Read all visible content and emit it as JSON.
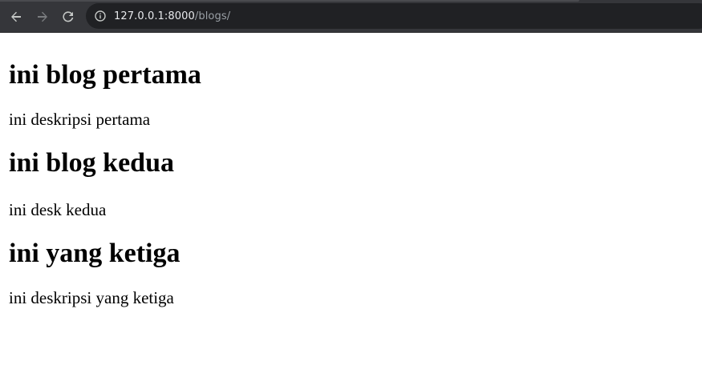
{
  "browser": {
    "url_host": "127.0.0.1:8000",
    "url_path": "/blogs/",
    "back_icon": "arrow-left-icon",
    "forward_icon": "arrow-right-icon",
    "reload_icon": "reload-icon",
    "info_icon": "info-icon"
  },
  "posts": [
    {
      "title": "ini blog pertama",
      "description": "ini deskripsi pertama"
    },
    {
      "title": "ini blog kedua",
      "description": "ini desk kedua"
    },
    {
      "title": "ini yang ketiga",
      "description": "ini deskripsi yang ketiga"
    }
  ]
}
